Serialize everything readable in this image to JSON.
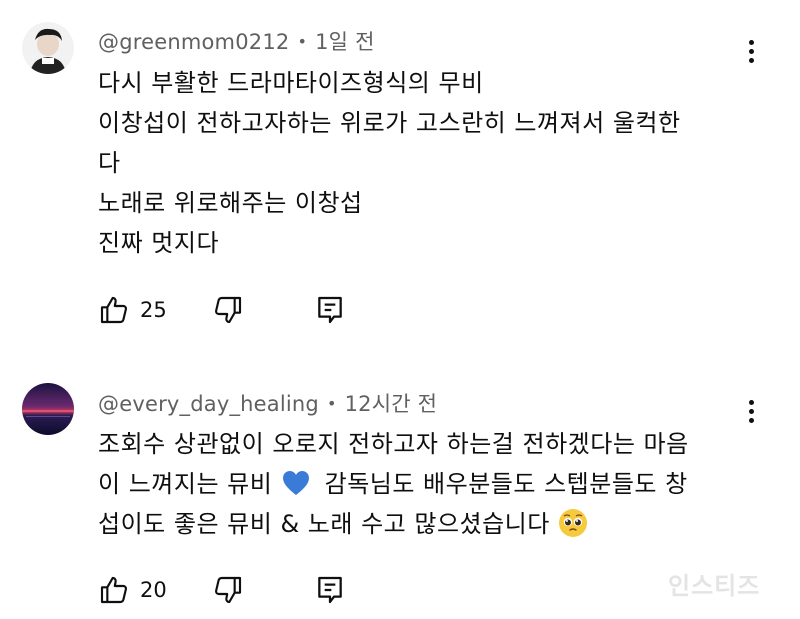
{
  "comments": [
    {
      "handle": "@greenmom0212",
      "time": "1일 전",
      "lines": [
        "다시 부활한 드라마타이즈형식의 무비",
        "이창섭이 전하고자하는 위로가 고스란히 느껴져서 울컥한",
        "다",
        "노래로 위로해주는 이창섭",
        "진짜 멋지다"
      ],
      "likes": "25"
    },
    {
      "handle": "@every_day_healing",
      "time": "12시간 전",
      "lines": [
        "조회수 상관없이 오로지 전하고자 하는걸 전하겠다는 마음",
        "이 느껴지는 뮤비",
        "감독님도 배우분들도 스텝분들도 창",
        "섭이도 좋은 뮤비 & 노래 수고 많으셨습니다"
      ],
      "likes": "20",
      "heart_color": "#3b7bd8"
    }
  ],
  "separator": "•",
  "watermark": "인스티즈",
  "icons": {
    "like": "thumbs-up-icon",
    "dislike": "thumbs-down-icon",
    "reply": "reply-icon",
    "more": "more-vert-icon"
  }
}
